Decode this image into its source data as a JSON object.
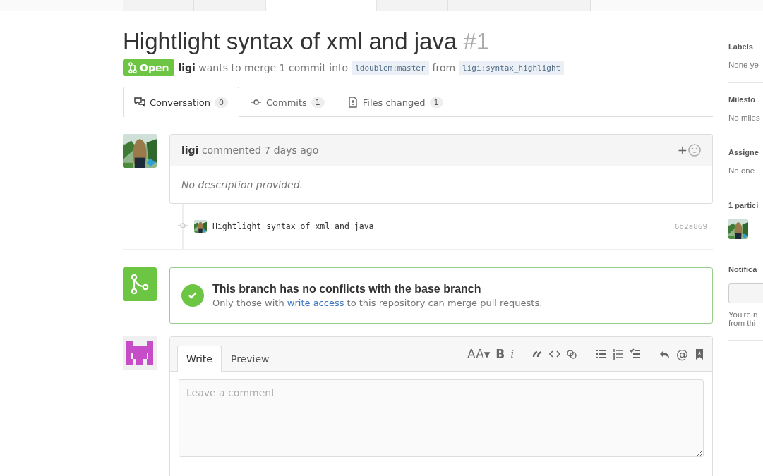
{
  "repo_tabs": [
    {
      "selected": false
    },
    {
      "selected": false
    },
    {
      "selected": true
    },
    {
      "selected": false
    },
    {
      "selected": false
    },
    {
      "selected": false
    }
  ],
  "title": {
    "text": "Hightlight syntax of xml and java",
    "number": "#1"
  },
  "meta": {
    "state": "Open",
    "author": "ligi",
    "text": "wants to merge 1 commit into",
    "base": "ldoublem:master",
    "from": "from",
    "head": "ligi:syntax_highlight"
  },
  "tabs": [
    {
      "kind": "conversation",
      "label": "Conversation",
      "count": "0",
      "selected": true
    },
    {
      "kind": "commits",
      "label": "Commits",
      "count": "1",
      "selected": false
    },
    {
      "kind": "files",
      "label": "Files changed",
      "count": "1",
      "selected": false
    }
  ],
  "comment": {
    "author": "ligi",
    "header": "commented 7 days ago",
    "reaction": "+",
    "body": "No description provided."
  },
  "commit": {
    "message": "Hightlight syntax of xml and java",
    "sha": "6b2a869"
  },
  "merge": {
    "title": "This branch has no conflicts with the base branch",
    "before": "Only those with",
    "link": "write access",
    "after": "to this repository can merge pull requests."
  },
  "editor": {
    "tabs": [
      {
        "label": "Write",
        "selected": true
      },
      {
        "label": "Preview",
        "selected": false
      }
    ],
    "toolbar": [
      [
        {
          "kind": "glyph",
          "text": "AA▾"
        },
        {
          "kind": "glyph",
          "text": "B",
          "bold": true
        },
        {
          "kind": "glyph",
          "text": "i",
          "italic": true
        }
      ],
      [
        {
          "kind": "quote"
        },
        {
          "kind": "code"
        },
        {
          "kind": "link"
        }
      ],
      [
        {
          "kind": "ul"
        },
        {
          "kind": "ol"
        },
        {
          "kind": "task"
        }
      ],
      [
        {
          "kind": "reply"
        },
        {
          "kind": "glyph",
          "text": "@"
        },
        {
          "kind": "bookmark"
        }
      ]
    ],
    "placeholder": "Leave a comment"
  },
  "sidebar": [
    {
      "heading": "Labels",
      "value": "None ye"
    },
    {
      "heading": "Milesto",
      "value": "No miles"
    },
    {
      "heading": "Assigne",
      "value": "No one"
    },
    {
      "heading": "1 partici",
      "kind": "avatars"
    },
    {
      "heading": "Notifica",
      "kind": "button",
      "lines": [
        "You're n",
        "from thi"
      ]
    }
  ]
}
